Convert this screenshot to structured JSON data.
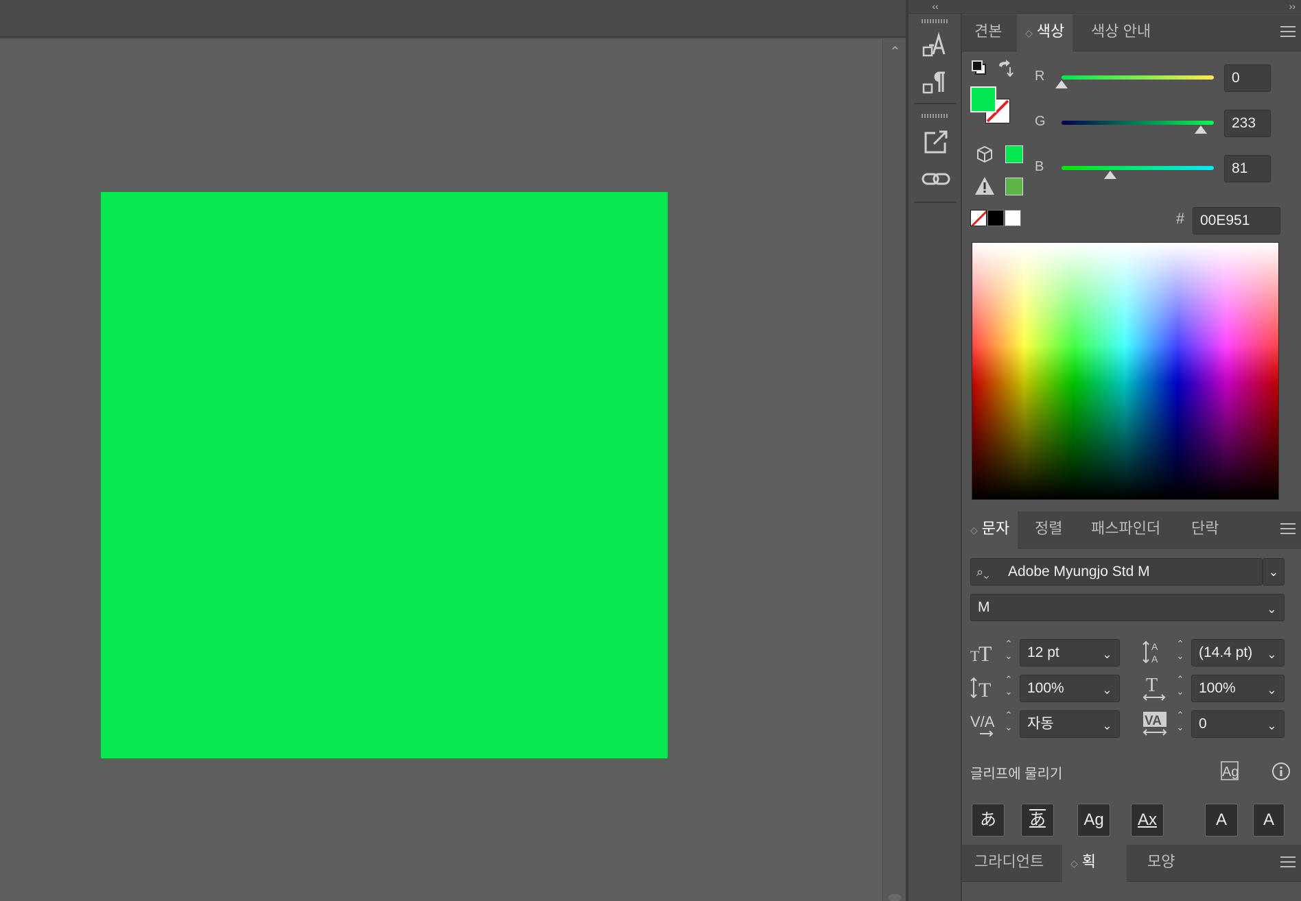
{
  "canvas": {
    "artboard_color": "#08E851",
    "scroll_up_icon": "chevron-up-icon"
  },
  "strip": {
    "collapse": "‹‹"
  },
  "panel": {
    "collapse": "››",
    "color_tabs": [
      {
        "label": "견본"
      },
      {
        "label": "색상"
      },
      {
        "label": "색상 안내"
      }
    ],
    "rgb": {
      "r_label": "R",
      "r_value": "0",
      "g_label": "G",
      "g_value": "233",
      "b_label": "B",
      "b_value": "81",
      "r_level": 0,
      "g_level": 0.914,
      "b_level": 0.318
    },
    "hex_label": "#",
    "hex_value": "00E951",
    "fill_color": "#00E951",
    "char_tabs": [
      {
        "label": "문자"
      },
      {
        "label": "정렬"
      },
      {
        "label": "패스파인더"
      },
      {
        "label": "단락"
      }
    ],
    "font_family": "Adobe Myungjo Std M",
    "font_style": "M",
    "font_size": "12 pt",
    "leading": "(14.4 pt)",
    "vertical_scale": "100%",
    "horizontal_scale": "100%",
    "kerning": "자동",
    "tracking": "0",
    "snap_label": "글리프에 물리기",
    "glyph_buttons": [
      "あ",
      "あ",
      "Ag",
      "Ax",
      "A",
      "A"
    ],
    "bottom_tabs": [
      {
        "label": "그라디언트"
      },
      {
        "label": "획"
      },
      {
        "label": "모양"
      }
    ]
  }
}
